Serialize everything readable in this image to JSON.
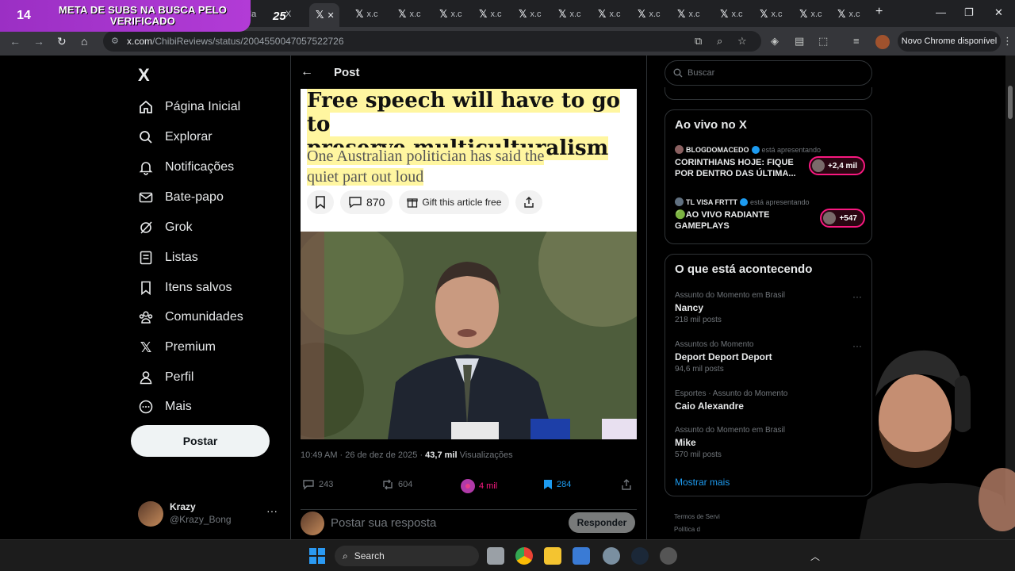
{
  "stream_overlay": {
    "count": "14",
    "message": "META DE SUBS NA BUSCA PELO VERIFICADO",
    "badge": "25"
  },
  "browser": {
    "tabs": [
      {
        "label": "Ma"
      },
      {
        "label": "X"
      },
      {
        "label": ""
      },
      {
        "label": "x.c"
      },
      {
        "label": "x.c"
      },
      {
        "label": "x.c"
      },
      {
        "label": "x.c"
      },
      {
        "label": "x.c"
      },
      {
        "label": "x.c"
      },
      {
        "label": "x.c"
      },
      {
        "label": "x.c"
      },
      {
        "label": "x.c"
      },
      {
        "label": "x.c"
      },
      {
        "label": "x.c"
      },
      {
        "label": "x.c"
      }
    ],
    "url_host": "x.com",
    "url_path": "/ChibiReviews/status/2004550047057522726",
    "new_chrome_label": "Novo Chrome disponível"
  },
  "sidebar": {
    "logo": "X",
    "items": [
      {
        "label": "Página Inicial",
        "icon": "home-icon"
      },
      {
        "label": "Explorar",
        "icon": "search-icon"
      },
      {
        "label": "Notificações",
        "icon": "bell-icon"
      },
      {
        "label": "Bate-papo",
        "icon": "mail-icon"
      },
      {
        "label": "Grok",
        "icon": "grok-icon"
      },
      {
        "label": "Listas",
        "icon": "list-icon"
      },
      {
        "label": "Itens salvos",
        "icon": "bookmark-icon"
      },
      {
        "label": "Comunidades",
        "icon": "communities-icon"
      },
      {
        "label": "Premium",
        "icon": "x-premium-icon"
      },
      {
        "label": "Perfil",
        "icon": "profile-icon"
      },
      {
        "label": "Mais",
        "icon": "more-icon"
      }
    ],
    "post_button": "Postar",
    "account": {
      "name": "Krazy",
      "handle": "@Krazy_Bong",
      "menu": "···"
    }
  },
  "main": {
    "header_title": "Post",
    "article": {
      "headline_line1": "Free speech will have to go to",
      "headline_line2": "preserve multiculturalism",
      "subhead_line1": "One Australian politician has said the",
      "subhead_line2": "quiet part out loud",
      "comments": "870",
      "gift_label": "Gift this article free"
    },
    "meta": {
      "time": "10:49 AM · 26 de dez de 2025 · ",
      "views_count": "43,7 mil",
      "views_label": " Visualizações"
    },
    "actions": {
      "replies": "243",
      "reposts": "604",
      "likes": "4 mil",
      "bookmarks": "284"
    },
    "reply_placeholder": "Postar sua resposta",
    "reply_button": "Responder"
  },
  "right": {
    "search_placeholder": "Buscar",
    "live": {
      "title": "Ao vivo no X",
      "items": [
        {
          "host": "BLOGDOMACEDO",
          "presenting": "está apresentando",
          "title": "CORINTHIANS HOJE: FIQUE POR DENTRO DAS ÚLTIMA...",
          "count": "+2,4 mil"
        },
        {
          "host": "TL VISA FRTTT",
          "presenting": "está apresentando",
          "title": "🟢AO VIVO RADIANTE GAMEPLAYS",
          "count": "+547"
        }
      ]
    },
    "trends": {
      "title": "O que está acontecendo",
      "items": [
        {
          "context": "Assunto do Momento em Brasil",
          "name": "Nancy",
          "count": "218 mil posts"
        },
        {
          "context": "Assuntos do Momento",
          "name": "Deport Deport Deport",
          "count": "94,6 mil posts"
        },
        {
          "context": "Esportes · Assunto do Momento",
          "name": "Caio Alexandre",
          "count": ""
        },
        {
          "context": "Assunto do Momento em Brasil",
          "name": "Mike",
          "count": "570 mil posts"
        }
      ],
      "show_more": "Mostrar mais"
    },
    "footer_line1": "Termos de Servi",
    "footer_line2": "Política d"
  },
  "taskbar": {
    "search_label": "Search"
  }
}
